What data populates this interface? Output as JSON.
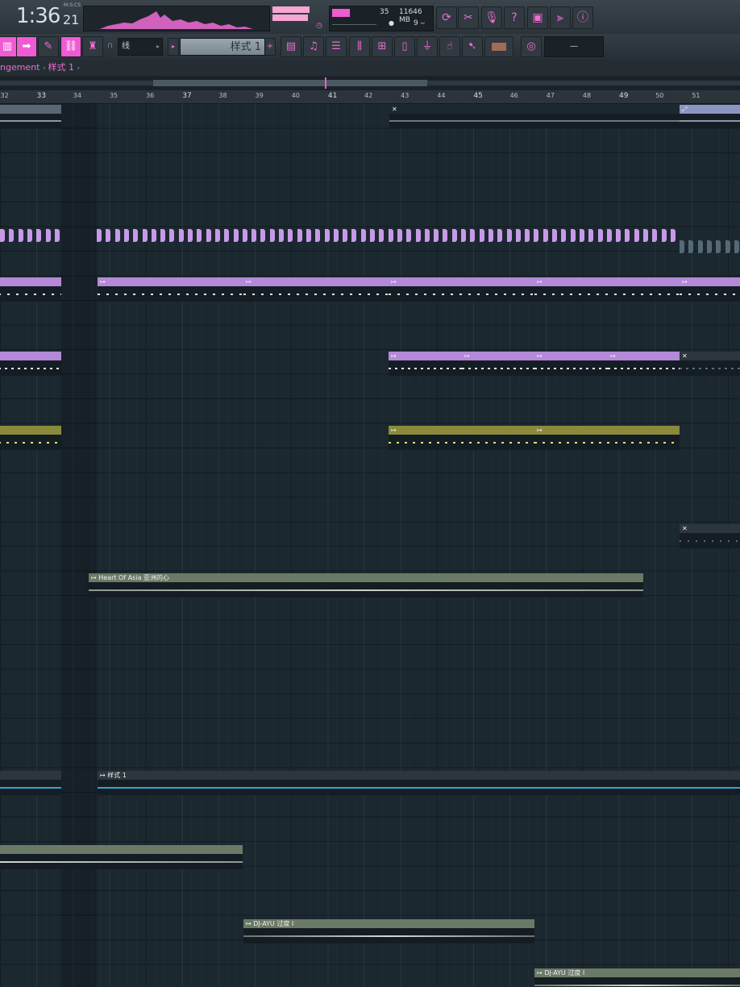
{
  "toolbar": {
    "time_main": "1:36",
    "time_sub": "21",
    "time_label": "M:S:CS",
    "cpu_value": "35",
    "memory": "11646 MB",
    "voices": "9"
  },
  "toolbar2": {
    "snap_label": "线",
    "pattern_label": "样式 1",
    "selector_value": "—"
  },
  "breadcrumb": {
    "items": [
      "ngement",
      "样式 1"
    ]
  },
  "ruler": {
    "ticks": [
      "32",
      "33",
      "34",
      "35",
      "36",
      "37",
      "38",
      "39",
      "40",
      "41",
      "42",
      "43",
      "44",
      "45",
      "46",
      "47",
      "48",
      "49",
      "50",
      "51"
    ]
  },
  "clips": {
    "heart_of_asia": "Heart Of Asia 亚洲的心",
    "pattern_1": "样式 1",
    "dj_ayu_1": "DJ-AYU 过度 Ⅰ",
    "dj_ayu_2": "DJ-AYU 过度 Ⅰ"
  },
  "colors": {
    "accent": "#f05ad2",
    "purple_clip": "#b48ad8",
    "olive_clip": "#8a8a3c",
    "grey_clip": "#6b7a66",
    "background": "#1c2830"
  }
}
